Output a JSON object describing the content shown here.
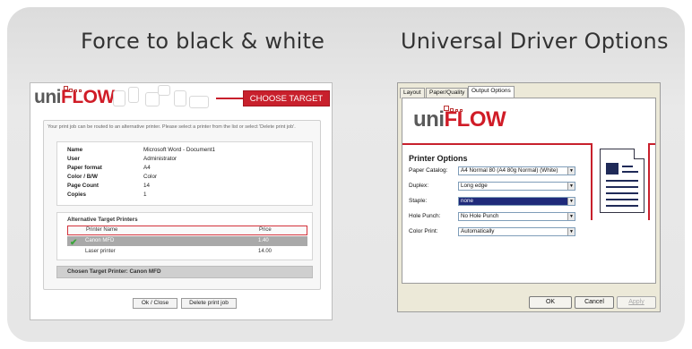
{
  "titles": {
    "left": "Force to black & white",
    "right": "Universal Driver Options"
  },
  "left_screen": {
    "logo": {
      "uni": "uni",
      "flow": "FLOW"
    },
    "banner": "CHOOSE TARGET PRINTER",
    "intro": "Your print job can be routed to an alternative printer. Please select a printer from the list or select 'Delete print job'.",
    "info": [
      {
        "label": "Name",
        "value": "Microsoft Word - Document1"
      },
      {
        "label": "User",
        "value": "Administrator"
      },
      {
        "label": "Paper format",
        "value": "A4"
      },
      {
        "label": "Color / B/W",
        "value": "Color"
      },
      {
        "label": "Page Count",
        "value": "14"
      },
      {
        "label": "Copies",
        "value": "1"
      }
    ],
    "alt_title": "Alternative Target Printers",
    "alt_headers": {
      "name": "Printer Name",
      "price": "Price"
    },
    "alt_rows": [
      {
        "name": "Canon MFD",
        "price": "1.40",
        "selected": true
      },
      {
        "name": "Laser printer",
        "price": "14.00",
        "selected": false
      }
    ],
    "chosen": "Chosen Target Printer: Canon MFD",
    "buttons": {
      "ok": "Ok / Close",
      "delete": "Delete print job"
    }
  },
  "right_screen": {
    "tabs": [
      "Layout",
      "Paper/Quality",
      "Output Options"
    ],
    "active_tab": "Output Options",
    "logo": {
      "uni": "uni",
      "flow": "FLOW"
    },
    "section_title": "Printer Options",
    "options": [
      {
        "label": "Paper Catalog:",
        "value": "A4 Normal 80 (A4 80g Normal) (White)",
        "highlighted": false
      },
      {
        "label": "Duplex:",
        "value": "Long edge",
        "highlighted": false
      },
      {
        "label": "Staple:",
        "value": "none",
        "highlighted": true
      },
      {
        "label": "Hole Punch:",
        "value": "No Hole Punch",
        "highlighted": false
      },
      {
        "label": "Color Print:",
        "value": "Automatically",
        "highlighted": false
      }
    ],
    "buttons": {
      "ok": "OK",
      "cancel": "Cancel",
      "apply": "Apply"
    }
  },
  "colors": {
    "brand_red": "#c8202c",
    "selection": "#1f2a7a",
    "card_bg": "#e6e6e6"
  }
}
